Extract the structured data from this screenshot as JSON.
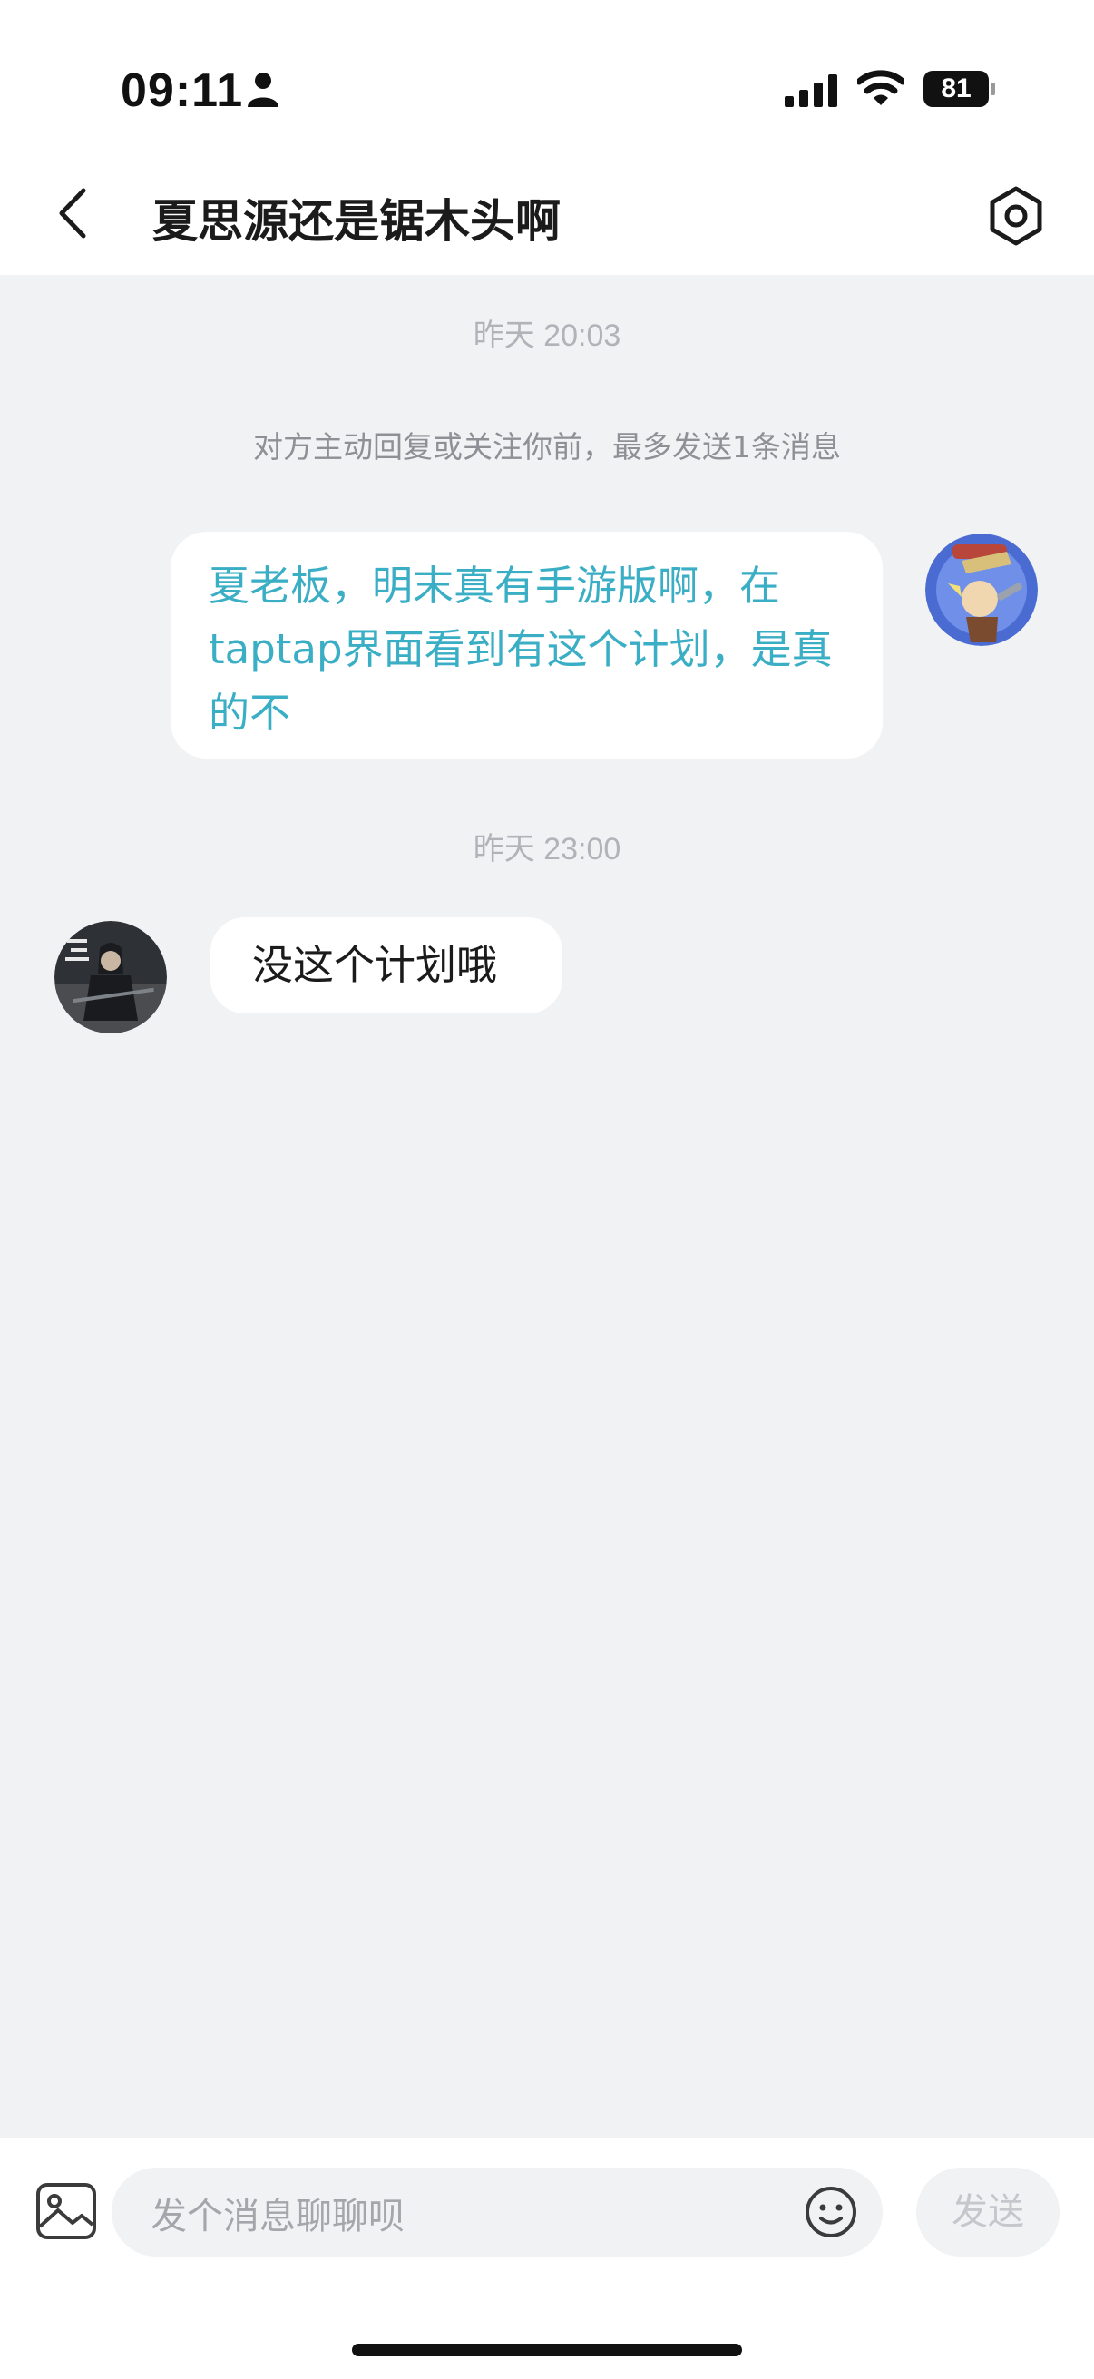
{
  "status_bar": {
    "time": "09:11",
    "battery": "81"
  },
  "header": {
    "title": "夏思源还是锯木头啊"
  },
  "chat": {
    "timestamp_1": "昨天 20:03",
    "notice": "对方主动回复或关注你前，最多发送1条消息",
    "sent_message": "夏老板，明末真有手游版啊，在taptap界面看到有这个计划，是真的不",
    "timestamp_2": "昨天 23:00",
    "received_message": "没这个计划哦"
  },
  "composer": {
    "placeholder": "发个消息聊聊呗",
    "send_label": "发送"
  },
  "colors": {
    "accent_text": "#3aaec4",
    "background": "#f1f2f4"
  },
  "icons": [
    "person-icon",
    "signal-icon",
    "wifi-icon",
    "battery-icon",
    "back-arrow-icon",
    "settings-hexagon-icon",
    "image-icon",
    "emoji-icon"
  ]
}
